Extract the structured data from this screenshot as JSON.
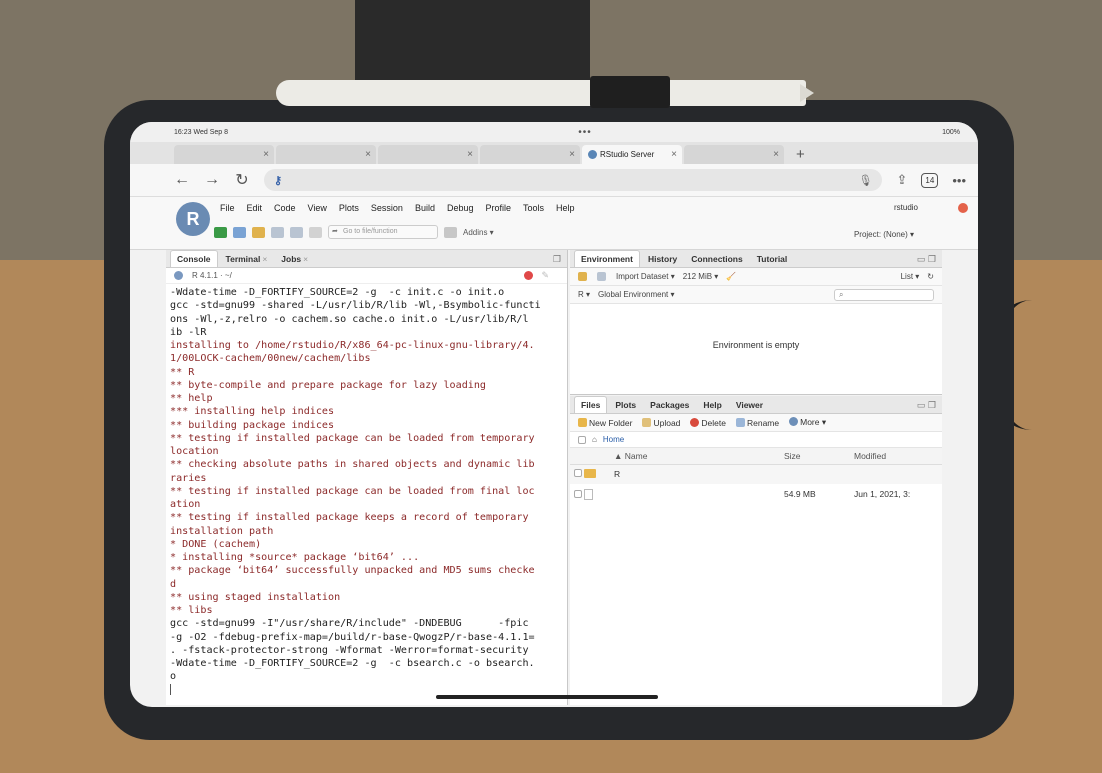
{
  "status_bar": {
    "time": "16:23",
    "date": "Wed Sep 8",
    "multitask_dots": "•••",
    "battery": "100%"
  },
  "browser": {
    "tabs": [
      {
        "label": "",
        "close": "×"
      },
      {
        "label": "",
        "close": "×"
      },
      {
        "label": "",
        "close": "×"
      },
      {
        "label": "",
        "close": "×"
      },
      {
        "label": "RStudio Server",
        "close": "×",
        "active": true
      },
      {
        "label": "",
        "close": "×"
      }
    ],
    "new_tab": "+",
    "url": "",
    "tab_count": "14"
  },
  "rstudio": {
    "logo": "R",
    "menu": [
      "File",
      "Edit",
      "Code",
      "View",
      "Plots",
      "Session",
      "Build",
      "Debug",
      "Profile",
      "Tools",
      "Help"
    ],
    "user": "rstudio",
    "goto_file_placeholder": "Go to file/function",
    "addins": "Addins ▾",
    "project": "Project: (None) ▾"
  },
  "console_pane": {
    "tabs": [
      {
        "label": "Console",
        "active": true
      },
      {
        "label": "Terminal",
        "close": "×"
      },
      {
        "label": "Jobs",
        "close": "×"
      }
    ],
    "r_version": "R 4.1.1 · ~/",
    "lines": [
      {
        "t": "cmd",
        "s": "-Wdate-time -D_FORTIFY_SOURCE=2 -g  -c init.c -o init.o"
      },
      {
        "t": "cmd",
        "s": "gcc -std=gnu99 -shared -L/usr/lib/R/lib -Wl,-Bsymbolic-functi"
      },
      {
        "t": "cmd",
        "s": "ons -Wl,-z,relro -o cachem.so cache.o init.o -L/usr/lib/R/l"
      },
      {
        "t": "cmd",
        "s": "ib -lR"
      },
      {
        "t": "msg",
        "s": "installing to /home/rstudio/R/x86_64-pc-linux-gnu-library/4."
      },
      {
        "t": "msg",
        "s": "1/00LOCK-cachem/00new/cachem/libs"
      },
      {
        "t": "msg",
        "s": "** R"
      },
      {
        "t": "msg",
        "s": "** byte-compile and prepare package for lazy loading"
      },
      {
        "t": "msg",
        "s": "** help"
      },
      {
        "t": "msg",
        "s": "*** installing help indices"
      },
      {
        "t": "msg",
        "s": "** building package indices"
      },
      {
        "t": "msg",
        "s": "** testing if installed package can be loaded from temporary"
      },
      {
        "t": "msg",
        "s": "location"
      },
      {
        "t": "msg",
        "s": "** checking absolute paths in shared objects and dynamic lib"
      },
      {
        "t": "msg",
        "s": "raries"
      },
      {
        "t": "msg",
        "s": "** testing if installed package can be loaded from final loc"
      },
      {
        "t": "msg",
        "s": "ation"
      },
      {
        "t": "msg",
        "s": "** testing if installed package keeps a record of temporary"
      },
      {
        "t": "msg",
        "s": "installation path"
      },
      {
        "t": "msg",
        "s": "* DONE (cachem)"
      },
      {
        "t": "msg",
        "s": "* installing *source* package ‘bit64’ ..."
      },
      {
        "t": "msg",
        "s": "** package ‘bit64’ successfully unpacked and MD5 sums checke"
      },
      {
        "t": "msg",
        "s": "d"
      },
      {
        "t": "msg",
        "s": "** using staged installation"
      },
      {
        "t": "msg",
        "s": "** libs"
      },
      {
        "t": "cmd",
        "s": "gcc -std=gnu99 -I\"/usr/share/R/include\" -DNDEBUG      -fpic"
      },
      {
        "t": "cmd",
        "s": "-g -O2 -fdebug-prefix-map=/build/r-base-QwogzP/r-base-4.1.1="
      },
      {
        "t": "cmd",
        "s": ". -fstack-protector-strong -Wformat -Werror=format-security"
      },
      {
        "t": "cmd",
        "s": "-Wdate-time -D_FORTIFY_SOURCE=2 -g  -c bsearch.c -o bsearch."
      },
      {
        "t": "cmd",
        "s": "o"
      }
    ]
  },
  "environment_pane": {
    "tabs": [
      "Environment",
      "History",
      "Connections",
      "Tutorial"
    ],
    "import_dataset": "Import Dataset ▾",
    "memory": "212 MiB ▾",
    "list_view": "List ▾",
    "lang": "R ▾",
    "scope": "Global Environment ▾",
    "empty_message": "Environment is empty"
  },
  "files_pane": {
    "tabs": [
      "Files",
      "Plots",
      "Packages",
      "Help",
      "Viewer"
    ],
    "toolbar": [
      "New Folder",
      "Upload",
      "Delete",
      "Rename",
      "More ▾"
    ],
    "breadcrumb": "Home",
    "columns": [
      "▲ Name",
      "Size",
      "Modified"
    ],
    "rows": [
      {
        "type": "folder",
        "name": "R",
        "size": "",
        "modified": ""
      },
      {
        "type": "file",
        "name": "",
        "size": "54.9 MB",
        "modified": "Jun 1, 2021, 3:"
      }
    ]
  }
}
